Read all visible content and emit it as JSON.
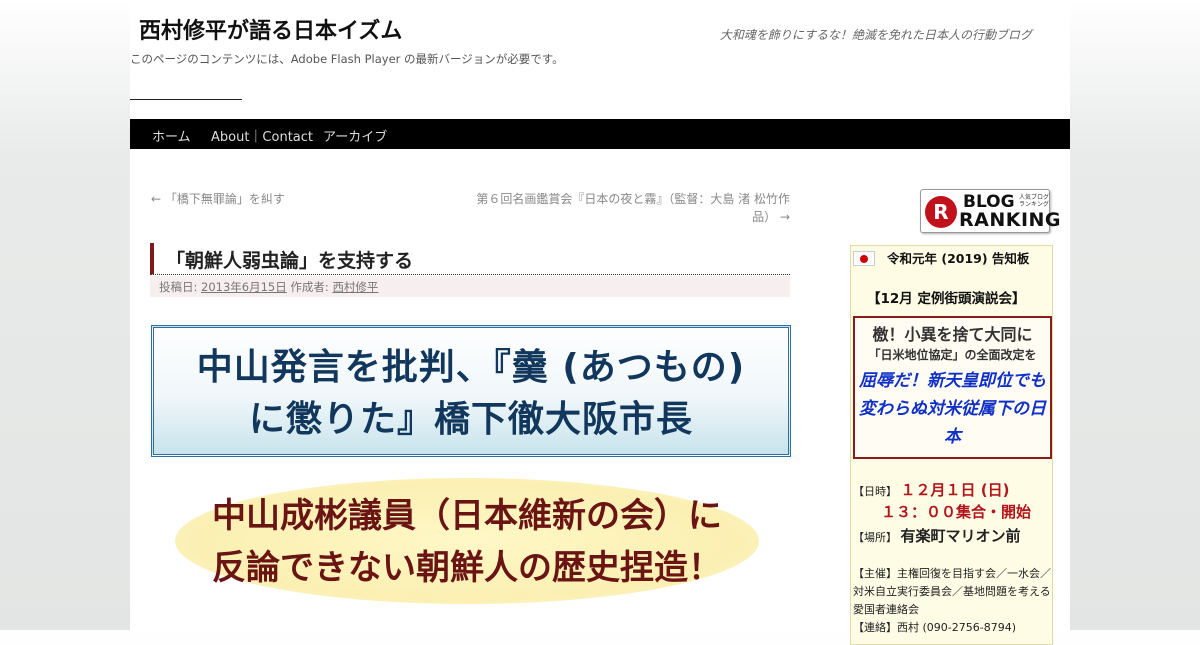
{
  "header": {
    "title": "西村修平が語る日本イズム",
    "tagline": "大和魂を飾りにするな！絶滅を免れた日本人の行動ブログ",
    "flash_note": "このページのコンテンツには、Adobe Flash Player の最新バージョンが必要です。"
  },
  "nav": {
    "items": [
      "ホーム",
      "About｜Contact",
      "アーカイブ"
    ]
  },
  "post_nav": {
    "prev": "← 「橋下無罪論」を糾す",
    "next": "第６回名画鑑賞会『日本の夜と霧』（監督：大島 渚 松竹作品） →"
  },
  "post": {
    "title": "「朝鮮人弱虫論」を支持する",
    "meta_prefix": "投稿日:",
    "date": "2013年6月15日",
    "author_prefix": "作成者:",
    "author": "西村修平",
    "banner1_line1": "中山発言を批判、『羹 (あつもの)",
    "banner1_line2": "に懲りた』橋下徹大阪市長",
    "banner2_line1": "中山成彬議員（日本維新の会）に",
    "banner2_line2": "反論できない朝鮮人の歴史捏造！"
  },
  "sidebar": {
    "ranking_line1": "BLOG",
    "ranking_line2": "RANKING",
    "ranking_tiny": "人気ブログランキング",
    "notice_title": "令和元年 (2019) 告知板",
    "event_title": "【12月 定例街頭演説会】",
    "slogan1": "檄！小異を捨て大同に",
    "slogan2": "「日米地位協定」の全面改定を",
    "slogan3": "屈辱だ！新天皇即位でも変わらぬ対米従属下の日本",
    "date_label": "【日時】",
    "date_value": "１２月１日 (日)",
    "time_value": "１３：００集合・開始",
    "place_label": "【場所】",
    "place_value": "有楽町マリオン前",
    "organizer": "【主催】主権回復を目指す会／一水会／対米自立実行委員会／基地問題を考える愛国者連絡会",
    "contact": "【連絡】西村 (090-2756-8794)"
  },
  "colors": {
    "nav_bg": "#000000",
    "title_accent": "#7a1c1c",
    "banner1_text": "#12375c",
    "banner2_text": "#6a1414",
    "event_red": "#b2161d",
    "slogan_blue": "#1030c8"
  }
}
